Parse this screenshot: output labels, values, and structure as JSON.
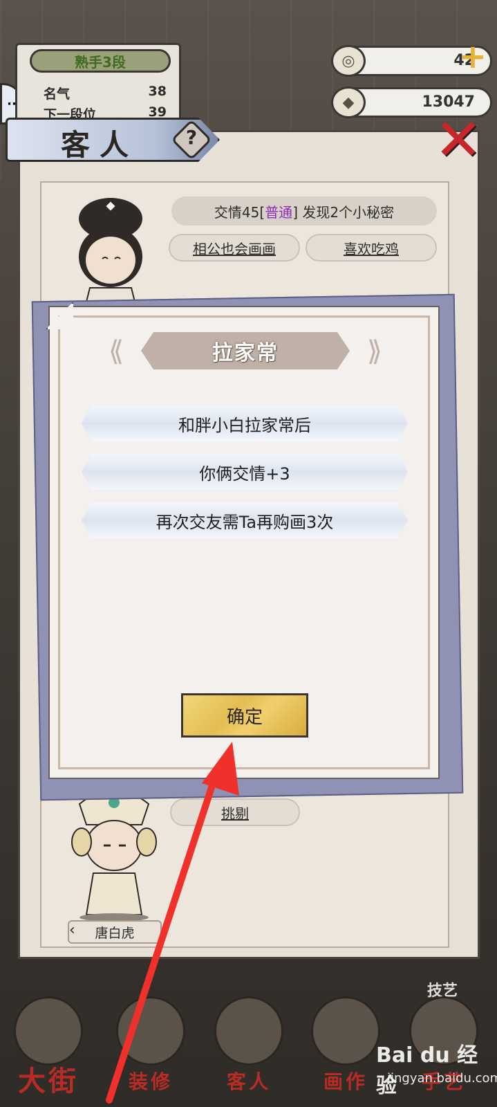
{
  "header": {
    "rank_badge": "熟手3段",
    "fame_label": "名气",
    "fame_value": "38",
    "next_rank_label": "下一段位",
    "next_rank_value": "39",
    "currency1_value": "42",
    "currency2_value": "13047"
  },
  "panel": {
    "title": "客人"
  },
  "guest_card_1": {
    "friendship_prefix": "交情45[",
    "friendship_level": "普通",
    "friendship_suffix": "] 发现2个小秘密",
    "secret_1": "相公也会画画",
    "secret_2": "喜欢吃鸡"
  },
  "guest_card_2": {
    "trait": "挑剔",
    "name": "唐白虎"
  },
  "dialog": {
    "title": "拉家常",
    "line_1": "和胖小白拉家常后",
    "line_2": "你俩交情+3",
    "line_3": "再次交友需Ta再购画3次",
    "confirm_label": "确定"
  },
  "side": {
    "skill_label": "技艺"
  },
  "nav": {
    "street": "大街",
    "decorate": "装修",
    "guests": "客人",
    "paint": "画作",
    "more": "手艺"
  },
  "watermark": {
    "brand": "Bai du 经验",
    "site": "jingyan.baidu.com"
  },
  "colors": {
    "dialog_bg": "#f3f0ee",
    "confirm_gold": "#e2bd52",
    "arrow_red": "#f0302a",
    "friendship_level": "#8b2bb8"
  }
}
